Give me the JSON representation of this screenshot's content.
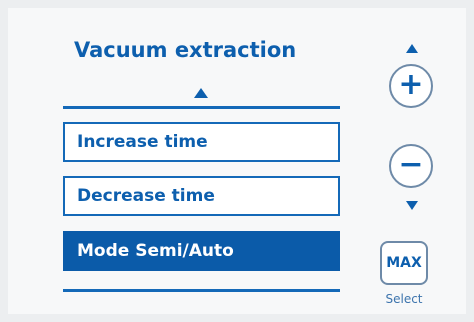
{
  "panel": {
    "title": "Vacuum extraction"
  },
  "menu": {
    "items": [
      {
        "label": "Increase time",
        "selected": false
      },
      {
        "label": "Decrease time",
        "selected": false
      },
      {
        "label": "Mode Semi/Auto",
        "selected": true
      }
    ]
  },
  "controls": {
    "plus_label": "+",
    "minus_label": "−",
    "max_label": "MAX",
    "select_label": "Select"
  },
  "icons": {
    "menu_scroll_up": "triangle-up-icon",
    "increase_arrow": "triangle-up-icon",
    "decrease_arrow": "triangle-down-icon"
  },
  "colors": {
    "accent": "#0d5fae",
    "selected_bg": "#0b5ba9",
    "border": "#6e8aa8",
    "background": "#f7f8f9"
  }
}
